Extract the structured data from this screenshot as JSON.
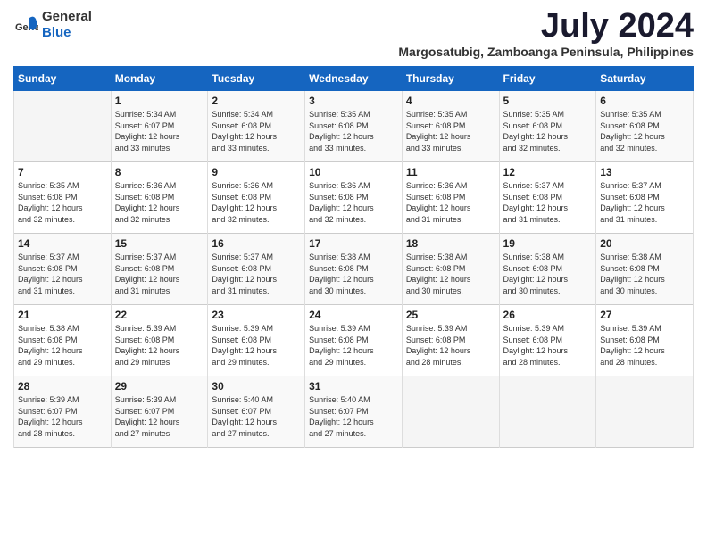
{
  "logo": {
    "general": "General",
    "blue": "Blue"
  },
  "title": "July 2024",
  "subtitle": "Margosatubig, Zamboanga Peninsula, Philippines",
  "days_of_week": [
    "Sunday",
    "Monday",
    "Tuesday",
    "Wednesday",
    "Thursday",
    "Friday",
    "Saturday"
  ],
  "weeks": [
    [
      {
        "day": "",
        "content": ""
      },
      {
        "day": "1",
        "content": "Sunrise: 5:34 AM\nSunset: 6:07 PM\nDaylight: 12 hours\nand 33 minutes."
      },
      {
        "day": "2",
        "content": "Sunrise: 5:34 AM\nSunset: 6:08 PM\nDaylight: 12 hours\nand 33 minutes."
      },
      {
        "day": "3",
        "content": "Sunrise: 5:35 AM\nSunset: 6:08 PM\nDaylight: 12 hours\nand 33 minutes."
      },
      {
        "day": "4",
        "content": "Sunrise: 5:35 AM\nSunset: 6:08 PM\nDaylight: 12 hours\nand 33 minutes."
      },
      {
        "day": "5",
        "content": "Sunrise: 5:35 AM\nSunset: 6:08 PM\nDaylight: 12 hours\nand 32 minutes."
      },
      {
        "day": "6",
        "content": "Sunrise: 5:35 AM\nSunset: 6:08 PM\nDaylight: 12 hours\nand 32 minutes."
      }
    ],
    [
      {
        "day": "7",
        "content": "Sunrise: 5:35 AM\nSunset: 6:08 PM\nDaylight: 12 hours\nand 32 minutes."
      },
      {
        "day": "8",
        "content": "Sunrise: 5:36 AM\nSunset: 6:08 PM\nDaylight: 12 hours\nand 32 minutes."
      },
      {
        "day": "9",
        "content": "Sunrise: 5:36 AM\nSunset: 6:08 PM\nDaylight: 12 hours\nand 32 minutes."
      },
      {
        "day": "10",
        "content": "Sunrise: 5:36 AM\nSunset: 6:08 PM\nDaylight: 12 hours\nand 32 minutes."
      },
      {
        "day": "11",
        "content": "Sunrise: 5:36 AM\nSunset: 6:08 PM\nDaylight: 12 hours\nand 31 minutes."
      },
      {
        "day": "12",
        "content": "Sunrise: 5:37 AM\nSunset: 6:08 PM\nDaylight: 12 hours\nand 31 minutes."
      },
      {
        "day": "13",
        "content": "Sunrise: 5:37 AM\nSunset: 6:08 PM\nDaylight: 12 hours\nand 31 minutes."
      }
    ],
    [
      {
        "day": "14",
        "content": "Sunrise: 5:37 AM\nSunset: 6:08 PM\nDaylight: 12 hours\nand 31 minutes."
      },
      {
        "day": "15",
        "content": "Sunrise: 5:37 AM\nSunset: 6:08 PM\nDaylight: 12 hours\nand 31 minutes."
      },
      {
        "day": "16",
        "content": "Sunrise: 5:37 AM\nSunset: 6:08 PM\nDaylight: 12 hours\nand 31 minutes."
      },
      {
        "day": "17",
        "content": "Sunrise: 5:38 AM\nSunset: 6:08 PM\nDaylight: 12 hours\nand 30 minutes."
      },
      {
        "day": "18",
        "content": "Sunrise: 5:38 AM\nSunset: 6:08 PM\nDaylight: 12 hours\nand 30 minutes."
      },
      {
        "day": "19",
        "content": "Sunrise: 5:38 AM\nSunset: 6:08 PM\nDaylight: 12 hours\nand 30 minutes."
      },
      {
        "day": "20",
        "content": "Sunrise: 5:38 AM\nSunset: 6:08 PM\nDaylight: 12 hours\nand 30 minutes."
      }
    ],
    [
      {
        "day": "21",
        "content": "Sunrise: 5:38 AM\nSunset: 6:08 PM\nDaylight: 12 hours\nand 29 minutes."
      },
      {
        "day": "22",
        "content": "Sunrise: 5:39 AM\nSunset: 6:08 PM\nDaylight: 12 hours\nand 29 minutes."
      },
      {
        "day": "23",
        "content": "Sunrise: 5:39 AM\nSunset: 6:08 PM\nDaylight: 12 hours\nand 29 minutes."
      },
      {
        "day": "24",
        "content": "Sunrise: 5:39 AM\nSunset: 6:08 PM\nDaylight: 12 hours\nand 29 minutes."
      },
      {
        "day": "25",
        "content": "Sunrise: 5:39 AM\nSunset: 6:08 PM\nDaylight: 12 hours\nand 28 minutes."
      },
      {
        "day": "26",
        "content": "Sunrise: 5:39 AM\nSunset: 6:08 PM\nDaylight: 12 hours\nand 28 minutes."
      },
      {
        "day": "27",
        "content": "Sunrise: 5:39 AM\nSunset: 6:08 PM\nDaylight: 12 hours\nand 28 minutes."
      }
    ],
    [
      {
        "day": "28",
        "content": "Sunrise: 5:39 AM\nSunset: 6:07 PM\nDaylight: 12 hours\nand 28 minutes."
      },
      {
        "day": "29",
        "content": "Sunrise: 5:39 AM\nSunset: 6:07 PM\nDaylight: 12 hours\nand 27 minutes."
      },
      {
        "day": "30",
        "content": "Sunrise: 5:40 AM\nSunset: 6:07 PM\nDaylight: 12 hours\nand 27 minutes."
      },
      {
        "day": "31",
        "content": "Sunrise: 5:40 AM\nSunset: 6:07 PM\nDaylight: 12 hours\nand 27 minutes."
      },
      {
        "day": "",
        "content": ""
      },
      {
        "day": "",
        "content": ""
      },
      {
        "day": "",
        "content": ""
      }
    ]
  ]
}
